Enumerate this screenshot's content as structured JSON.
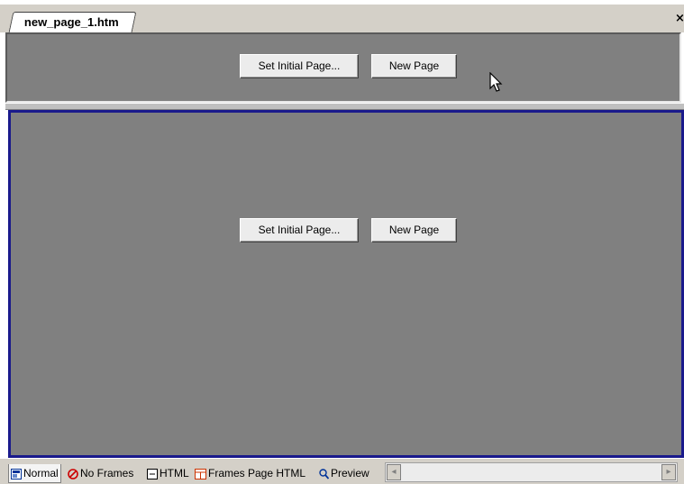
{
  "document": {
    "tab_title": "new_page_1.htm",
    "close_glyph": "×"
  },
  "frames": {
    "top": {
      "set_initial_page_label": "Set Initial Page...",
      "set_initial_page_mnemonic": "I",
      "new_page_label": "New Page",
      "new_page_mnemonic": "N"
    },
    "bottom": {
      "set_initial_page_label": "Set Initial Page...",
      "set_initial_page_mnemonic": "I",
      "new_page_label": "New Page",
      "new_page_mnemonic": "N"
    }
  },
  "view_tabs": [
    {
      "label": "Normal",
      "icon": "normal-view-icon",
      "selected": true
    },
    {
      "label": "No Frames",
      "icon": "no-frames-icon",
      "selected": false
    },
    {
      "label": "HTML",
      "icon": "html-icon",
      "selected": false
    },
    {
      "label": "Frames Page HTML",
      "icon": "frames-page-html-icon",
      "selected": false
    },
    {
      "label": "Preview",
      "icon": "preview-icon",
      "selected": false
    }
  ],
  "colors": {
    "frame_background": "#808080",
    "selected_frame_border": "#1a1a8c",
    "no_frames_icon": "#cc0000",
    "frames_page_icon": "#cc3300"
  }
}
